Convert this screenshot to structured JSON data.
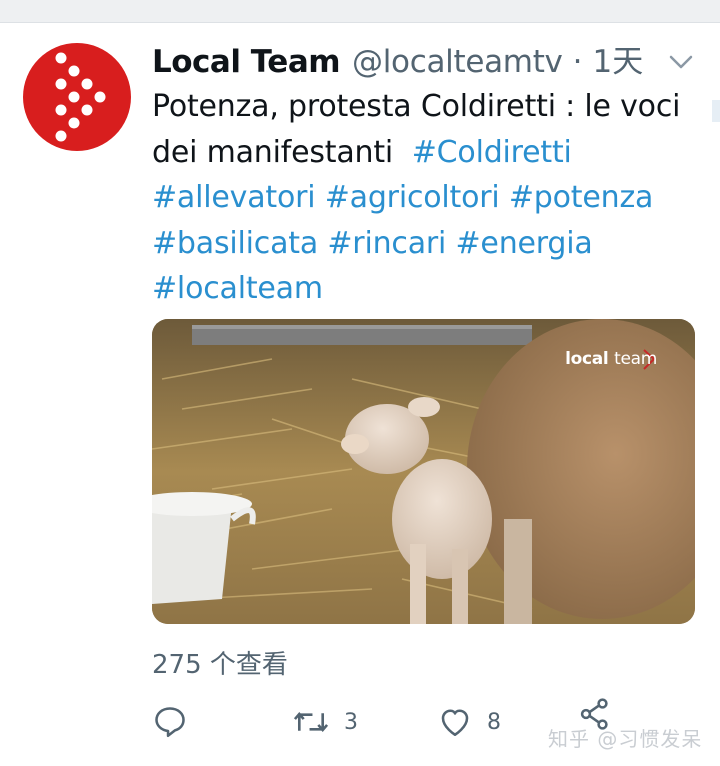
{
  "tweet": {
    "author_name": "Local Team",
    "handle": "@localteamtv",
    "separator": "·",
    "time": "1天",
    "text_plain": "Potenza, protesta Coldiretti : le voci dei manifestanti",
    "hashtags": [
      "#Coldiretti",
      "#allevatori",
      "#agricoltori",
      "#potenza",
      "#basilicata",
      "#rincari",
      "#energia",
      "#localteam"
    ],
    "media_watermark_bold": "local",
    "media_watermark_thin": "team",
    "views": "275 个查看",
    "reply_count": "",
    "retweet_count": "3",
    "like_count": "8"
  },
  "icons": {
    "avatar": "localteam-logo-icon",
    "more": "chevron-down-icon",
    "reply": "reply-icon",
    "retweet": "retweet-icon",
    "like": "heart-icon",
    "share": "share-icon"
  },
  "colors": {
    "hashtag": "#2a8fcf",
    "avatar_red": "#d81e1e",
    "secondary_text": "#536471"
  },
  "watermark_text": "知乎 @习惯发呆"
}
